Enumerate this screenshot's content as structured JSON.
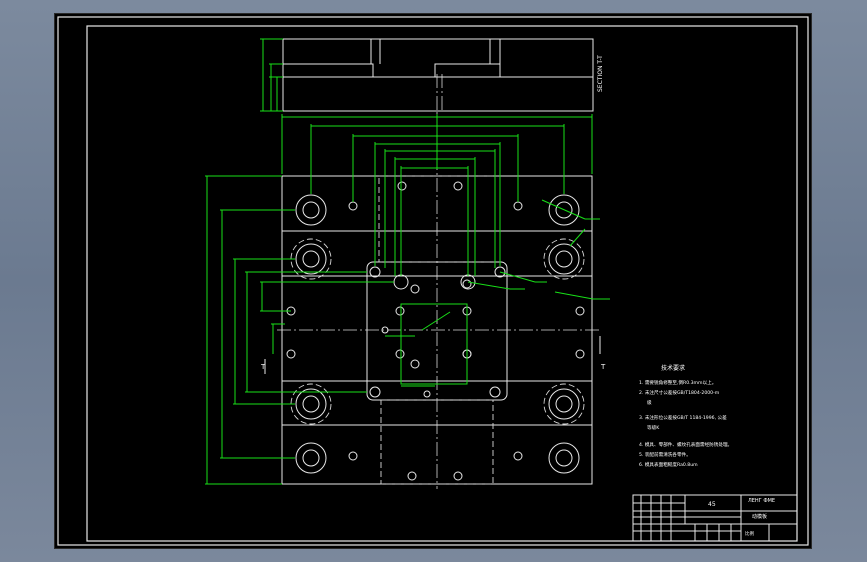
{
  "section_label": "SECTION T-T",
  "cut_marker": "T",
  "tech_requirements": {
    "title": "技术要求",
    "items": [
      "1. 需要锐角修整至,倒R0.3mm以上。",
      "2. 未注尺寸公差按GB/T1804-2000-m",
      "级",
      "3. 未注形位公差按GB/T 1184-1996, 公差",
      "等级K",
      "4. 模具、零部件、螺纹孔表面需经防锈处理。",
      "5. 装配前需清洗各零件。",
      "6. 模具表面粗糙度Ra0.8um"
    ]
  },
  "title_block": {
    "material": "45",
    "company": "ЛЕНГ ФМЕ",
    "drawing_name": "动模板",
    "scale_label": "比例"
  }
}
